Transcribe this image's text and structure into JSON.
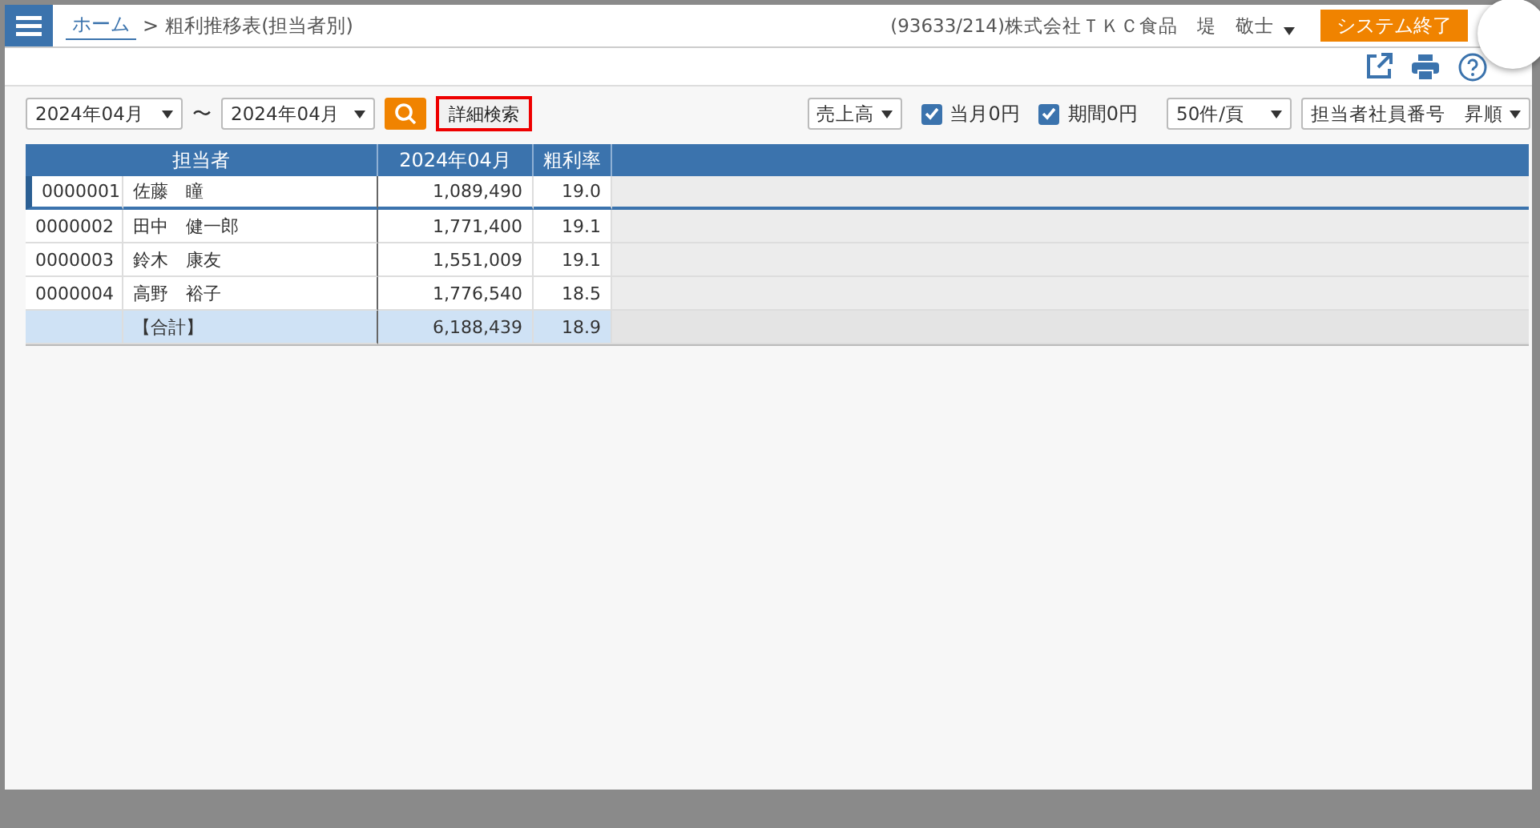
{
  "header": {
    "breadcrumb": {
      "home": "ホーム",
      "separator": ">",
      "current": "粗利推移表(担当者別)"
    },
    "user": "(93633/214)株式会社ＴＫＣ食品　堤　敬士",
    "exit_button": "システム終了"
  },
  "filters": {
    "period_from": "2024年04月",
    "tilde": "〜",
    "period_to": "2024年04月",
    "detail_search": {
      "label": "詳細検索",
      "highlighted": true
    },
    "measure": "売上高",
    "checkboxes": [
      {
        "label": "当月0円",
        "checked": true
      },
      {
        "label": "期間0円",
        "checked": true
      }
    ],
    "page_size": "50件/頁",
    "sort": "担当者社員番号　昇順"
  },
  "table": {
    "columns": [
      "担当者",
      "2024年04月",
      "粗利率"
    ],
    "rows": [
      {
        "code": "0000001",
        "name": "佐藤　瞳",
        "amount": "1,089,490",
        "rate": "19.0",
        "selected": true
      },
      {
        "code": "0000002",
        "name": "田中　健一郎",
        "amount": "1,771,400",
        "rate": "19.1",
        "selected": false
      },
      {
        "code": "0000003",
        "name": "鈴木　康友",
        "amount": "1,551,009",
        "rate": "19.1",
        "selected": false
      },
      {
        "code": "0000004",
        "name": "高野　裕子",
        "amount": "1,776,540",
        "rate": "18.5",
        "selected": false
      }
    ],
    "total": {
      "label": "【合計】",
      "amount": "6,188,439",
      "rate": "18.9"
    }
  }
}
